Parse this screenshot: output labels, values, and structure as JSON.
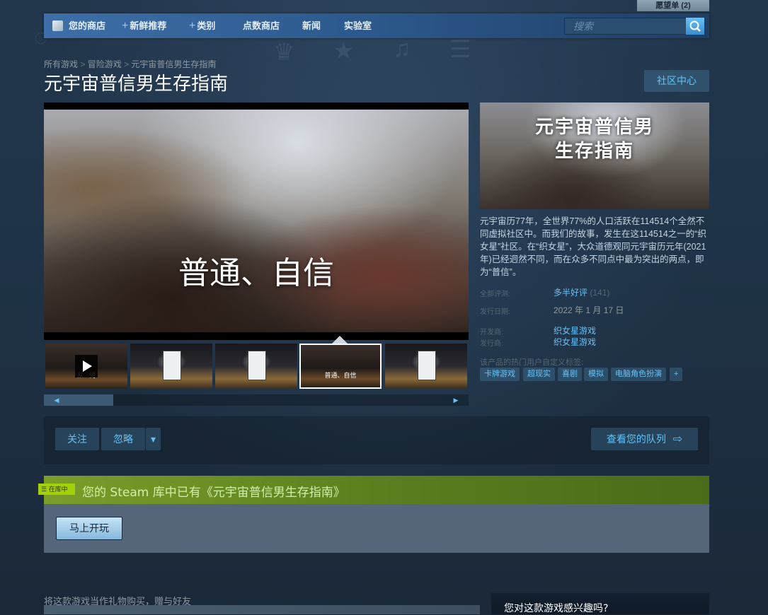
{
  "wishlist": {
    "label": "愿望单 (2)"
  },
  "nav": {
    "items": [
      {
        "label": "您的商店"
      },
      {
        "label": "新鲜推荐"
      },
      {
        "label": "类别"
      },
      {
        "label": "点数商店"
      },
      {
        "label": "新闻"
      },
      {
        "label": "实验室"
      }
    ],
    "search_placeholder": "搜索"
  },
  "breadcrumb": [
    "所有游戏",
    "冒险游戏",
    "元宇宙普信男生存指南"
  ],
  "game": {
    "title": "元宇宙普信男生存指南",
    "community_hub": "社区中心",
    "video_caption": "普通、自信",
    "capsule_line1": "元宇宙普信男",
    "capsule_line2": "生存指南",
    "description": "元宇宙历77年，全世界77%的人口活跃在114514个全然不同虚拟社区中。而我们的故事，发生在这114514之一的“织女星”社区。在“织女星”，大众道德观同元宇宙历元年(2021年)已经迥然不同，而在众多不同点中最为突出的两点，即为“普信”。",
    "reviews_label": "全部评测:",
    "reviews_value": "多半好评",
    "reviews_count": "(141)",
    "release_label": "发行日期:",
    "release_value": "2022 年 1 月 17 日",
    "developer_label": "开发商:",
    "developer_value": "织女星游戏",
    "publisher_label": "发行商:",
    "publisher_value": "织女星游戏",
    "tags_label": "该产品的热门用户自定义标签:",
    "tags": [
      "卡牌游戏",
      "超现实",
      "喜剧",
      "模拟",
      "电脑角色扮演",
      "+"
    ]
  },
  "thumbnails": [
    {
      "label": "从...词"
    },
    {
      "label": ""
    },
    {
      "label": ""
    },
    {
      "label": "普通、自信"
    },
    {
      "label": ""
    }
  ],
  "queue": {
    "follow": "关注",
    "ignore": "忽略",
    "dropdown": "▾",
    "view_queue": "查看您的队列"
  },
  "library": {
    "badge": "在库中",
    "message": "您的 Steam 库中已有《元宇宙普信男生存指南》",
    "play_now": "马上开玩"
  },
  "gift": {
    "text": "将这款游戏当作礼物购买，赠与好友"
  },
  "interest": {
    "title": "您对这款游戏感兴趣吗?"
  },
  "colors": {
    "accent": "#67c1f5",
    "background": "#1b2838",
    "library_green": "#a4d007"
  }
}
